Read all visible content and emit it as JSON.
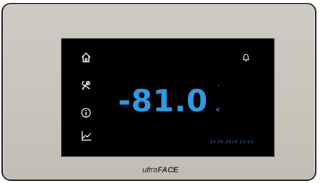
{
  "device": {
    "temperature": "-81.0",
    "unit": "c",
    "unit_prefix": "°",
    "datetime": "03.05.2016  13:14",
    "brand_light": "ultra",
    "brand_bold": "FACE"
  },
  "icons": {
    "sidebar": [
      "home-icon",
      "service-icon",
      "info-icon",
      "graph-icon"
    ],
    "top_right": "bell-icon"
  },
  "colors": {
    "accent": "#2f9be6",
    "screen": "#000000",
    "bezel": "#c8c4bc",
    "icon": "#ffffff"
  }
}
